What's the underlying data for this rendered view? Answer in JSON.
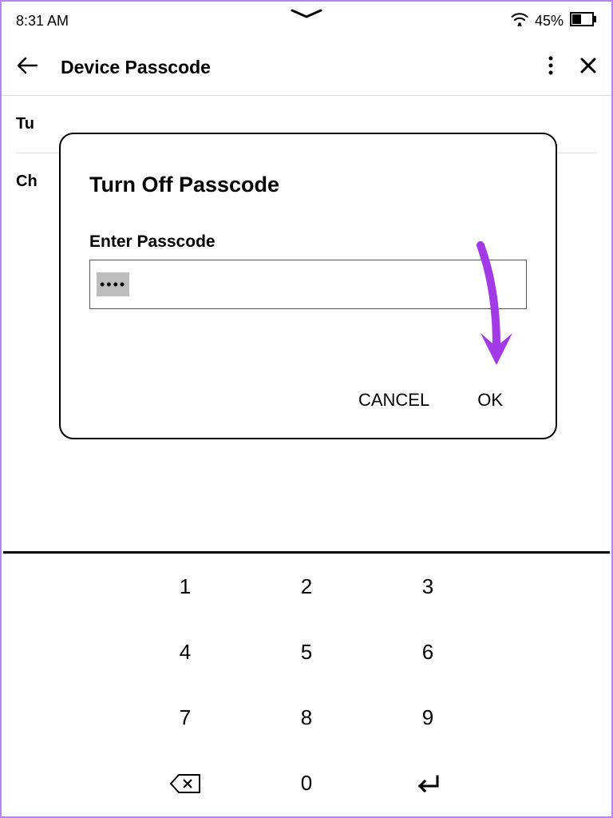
{
  "status": {
    "time": "8:31 AM",
    "battery_pct": "45%"
  },
  "header": {
    "title": "Device Passcode"
  },
  "content": {
    "items": [
      "Tu",
      "Ch"
    ]
  },
  "dialog": {
    "title": "Turn Off Passcode",
    "label": "Enter Passcode",
    "passcode_value": "••••",
    "cancel": "CANCEL",
    "ok": "OK"
  },
  "keypad": {
    "rows": [
      [
        "",
        "1",
        "2",
        "3",
        ""
      ],
      [
        "",
        "4",
        "5",
        "6",
        ""
      ],
      [
        "",
        "7",
        "8",
        "9",
        ""
      ],
      [
        "",
        "⌫",
        "0",
        "↵",
        ""
      ]
    ]
  }
}
